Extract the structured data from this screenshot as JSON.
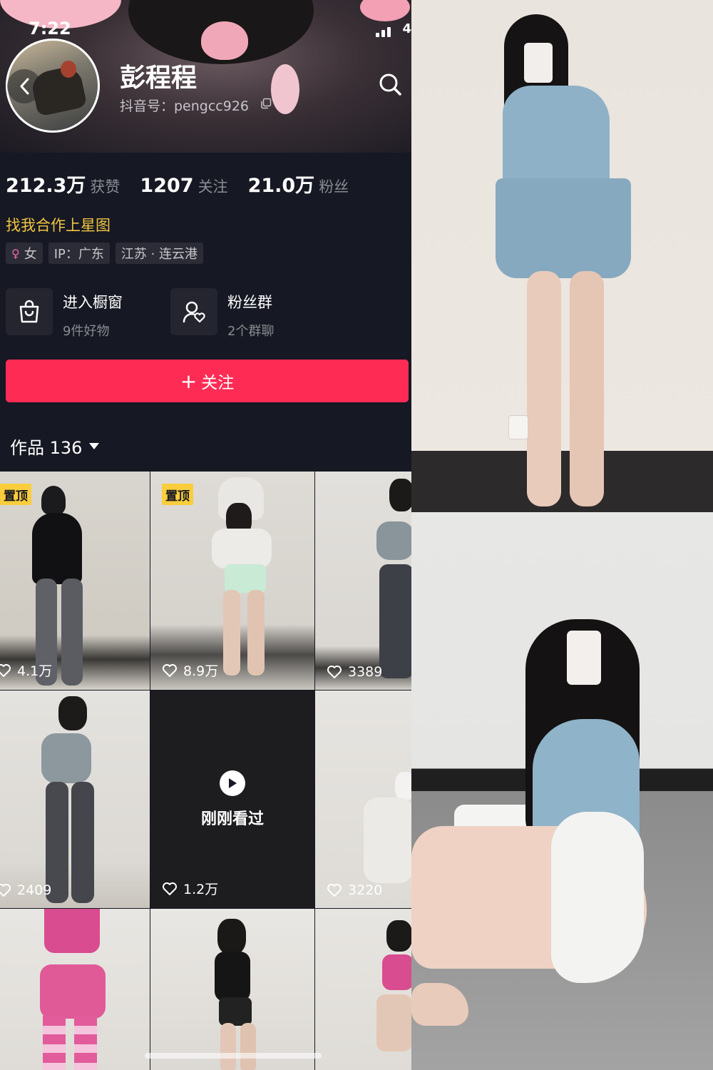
{
  "status_bar": {
    "time": "7:22",
    "battery": "4"
  },
  "profile": {
    "name": "彭程程",
    "douyin_id": "抖音号：pengcc926",
    "stats": [
      {
        "value": "212.3万",
        "label": "获赞"
      },
      {
        "value": "1207",
        "label": "关注"
      },
      {
        "value": "21.0万",
        "label": "粉丝"
      }
    ],
    "cooperation_link": "找我合作上星图",
    "tags": {
      "gender": "女",
      "ip": "IP：广东",
      "location": "江苏 · 连云港"
    },
    "features": [
      {
        "title": "进入橱窗",
        "subtitle": "9件好物",
        "icon": "shopping-bag-icon"
      },
      {
        "title": "粉丝群",
        "subtitle": "2个群聊",
        "icon": "fan-group-icon"
      }
    ],
    "follow_button": "关注"
  },
  "works": {
    "tab_label": "作品 136",
    "pin_label": "置顶",
    "recently_viewed_label": "刚刚看过",
    "tiles": [
      {
        "likes": "4.1万",
        "pinned": true
      },
      {
        "likes": "8.9万",
        "pinned": true
      },
      {
        "likes": "3389",
        "pinned": false
      },
      {
        "likes": "2409",
        "pinned": false
      },
      {
        "likes": "1.2万",
        "pinned": false,
        "recently_viewed": true
      },
      {
        "likes": "3220",
        "pinned": false
      },
      {
        "likes": "",
        "pinned": false
      },
      {
        "likes": "",
        "pinned": false
      },
      {
        "likes": "",
        "pinned": false
      }
    ]
  },
  "colors": {
    "accent": "#fe2c55",
    "background": "#161823",
    "link": "#f1c542",
    "pin": "#facd3b"
  }
}
